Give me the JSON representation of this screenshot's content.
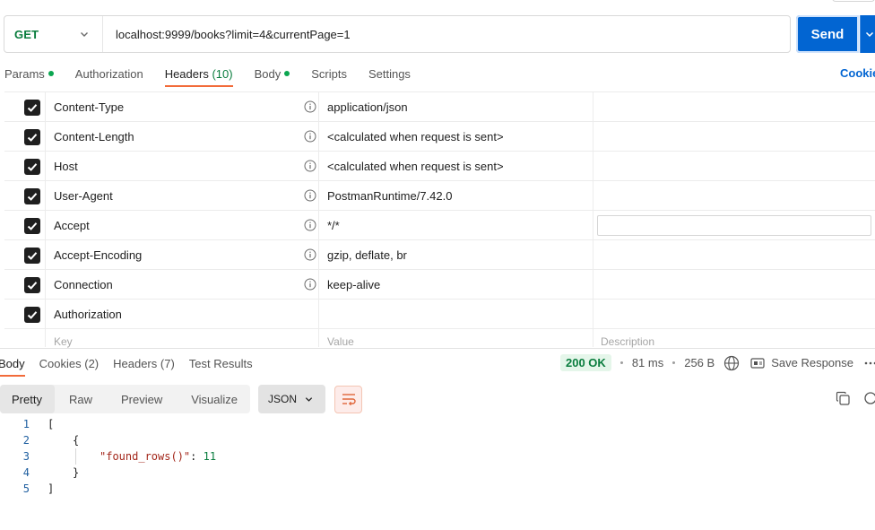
{
  "request": {
    "method": "GET",
    "url": "localhost:9999/books?limit=4&currentPage=1",
    "send_label": "Send"
  },
  "request_tabs": [
    {
      "label": "Params",
      "dot": true
    },
    {
      "label": "Authorization",
      "dot": false
    },
    {
      "label": "Headers",
      "count": "(10)",
      "active": true
    },
    {
      "label": "Body",
      "dot": true
    },
    {
      "label": "Scripts",
      "dot": false
    },
    {
      "label": "Settings",
      "dot": false
    }
  ],
  "cookies_link": "Cookies",
  "headers": [
    {
      "key": "Content-Type",
      "value": "application/json",
      "info": true
    },
    {
      "key": "Content-Length",
      "value": "<calculated when request is sent>",
      "info": true
    },
    {
      "key": "Host",
      "value": "<calculated when request is sent>",
      "info": true
    },
    {
      "key": "User-Agent",
      "value": "PostmanRuntime/7.42.0",
      "info": true
    },
    {
      "key": "Accept",
      "value": "*/*",
      "info": true,
      "desc_input": true
    },
    {
      "key": "Accept-Encoding",
      "value": "gzip, deflate, br",
      "info": true
    },
    {
      "key": "Connection",
      "value": "keep-alive",
      "info": true
    },
    {
      "key": "Authorization",
      "value": "",
      "info": false
    }
  ],
  "placeholders": {
    "key": "Key",
    "value": "Value",
    "description": "Description"
  },
  "response_tabs": {
    "body": "Body",
    "cookies": "Cookies",
    "cookies_count": "(2)",
    "headers": "Headers",
    "headers_count": "(7)",
    "tests": "Test Results"
  },
  "response_meta": {
    "status": "200 OK",
    "time": "81 ms",
    "size": "256 B",
    "save": "Save Response"
  },
  "view_modes": [
    "Pretty",
    "Raw",
    "Preview",
    "Visualize"
  ],
  "format": "JSON",
  "code_lines": [
    "1",
    "2",
    "3",
    "4",
    "5"
  ],
  "code": {
    "open_bracket": "[",
    "open_brace": "{",
    "key": "\"found_rows()\"",
    "colon": ": ",
    "value": "11",
    "close_brace": "}",
    "close_bracket": "]"
  }
}
